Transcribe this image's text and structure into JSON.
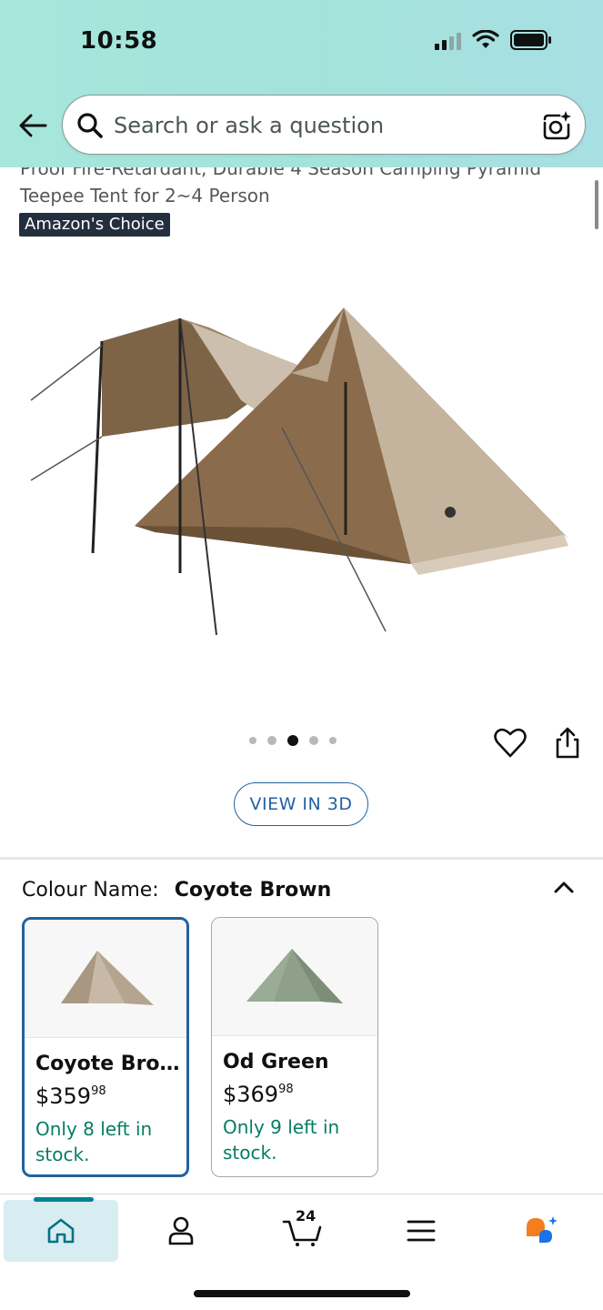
{
  "status_bar": {
    "time": "10:58"
  },
  "search": {
    "placeholder": "Search or ask a question"
  },
  "product": {
    "title_line1": "Proof Fire-Retardant, Durable 4 Season Camping Pyramid",
    "title_line2": "Teepee Tent for 2~4 Person",
    "badge": "Amazon's Choice",
    "carousel": {
      "total": 5,
      "active_index": 2
    },
    "view_3d_label": "VIEW IN 3D"
  },
  "colour": {
    "label": "Colour Name:",
    "selected_value": "Coyote Brown",
    "options": [
      {
        "name": "Coyote Bro...",
        "price_main": "$359",
        "price_fraction": "98",
        "stock": "Only 8 left in stock.",
        "color": "#c8b8a6",
        "selected": true
      },
      {
        "name": "Od Green",
        "price_main": "$369",
        "price_fraction": "98",
        "stock": "Only 9 left in stock.",
        "color": "#8ea08a",
        "selected": false
      }
    ]
  },
  "bottom_nav": {
    "items": [
      "home-icon",
      "account-icon",
      "cart-icon",
      "menu-icon",
      "rufus-icon"
    ],
    "cart_count": "24",
    "active": "home"
  },
  "colors": {
    "accent": "#2162a1",
    "stock_green": "#067d62",
    "badge_bg": "#232f3e",
    "nav_active": "#008296"
  }
}
